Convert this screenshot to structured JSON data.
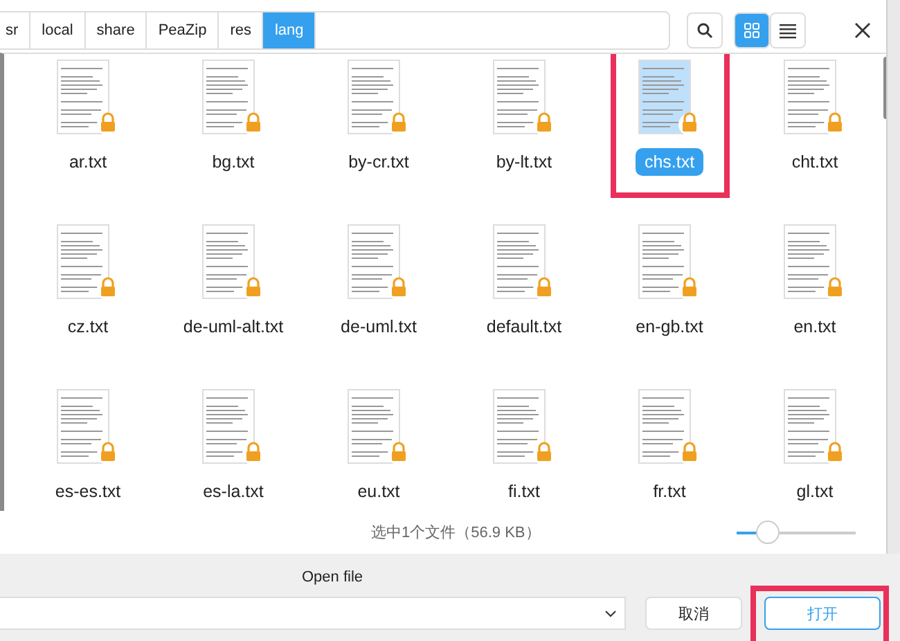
{
  "path_bar": [
    {
      "label": "sr",
      "selected": false
    },
    {
      "label": "local",
      "selected": false
    },
    {
      "label": "share",
      "selected": false
    },
    {
      "label": "PeaZip",
      "selected": false
    },
    {
      "label": "res",
      "selected": false
    },
    {
      "label": "lang",
      "selected": true
    }
  ],
  "view_modes": [
    {
      "kind": "grid",
      "selected": true
    },
    {
      "kind": "list",
      "selected": false
    }
  ],
  "files": [
    {
      "name": "ar.txt",
      "selected": false,
      "highlighted": false
    },
    {
      "name": "bg.txt",
      "selected": false,
      "highlighted": false
    },
    {
      "name": "by-cr.txt",
      "selected": false,
      "highlighted": false
    },
    {
      "name": "by-lt.txt",
      "selected": false,
      "highlighted": false
    },
    {
      "name": "chs.txt",
      "selected": true,
      "highlighted": true
    },
    {
      "name": "cht.txt",
      "selected": false,
      "highlighted": false
    },
    {
      "name": "cz.txt",
      "selected": false,
      "highlighted": false
    },
    {
      "name": "de-uml-alt.txt",
      "selected": false,
      "highlighted": false
    },
    {
      "name": "de-uml.txt",
      "selected": false,
      "highlighted": false
    },
    {
      "name": "default.txt",
      "selected": false,
      "highlighted": false
    },
    {
      "name": "en-gb.txt",
      "selected": false,
      "highlighted": false
    },
    {
      "name": "en.txt",
      "selected": false,
      "highlighted": false
    },
    {
      "name": "es-es.txt",
      "selected": false,
      "highlighted": false
    },
    {
      "name": "es-la.txt",
      "selected": false,
      "highlighted": false
    },
    {
      "name": "eu.txt",
      "selected": false,
      "highlighted": false
    },
    {
      "name": "fi.txt",
      "selected": false,
      "highlighted": false
    },
    {
      "name": "fr.txt",
      "selected": false,
      "highlighted": false
    },
    {
      "name": "gl.txt",
      "selected": false,
      "highlighted": false
    }
  ],
  "status": "选中1个文件（56.9 KB）",
  "zoom_slider": {
    "level": 0.25
  },
  "title": "Open file",
  "buttons": [
    {
      "label": "取消",
      "kind": "cancel"
    },
    {
      "label": "打开",
      "kind": "primary",
      "highlighted": true
    }
  ]
}
